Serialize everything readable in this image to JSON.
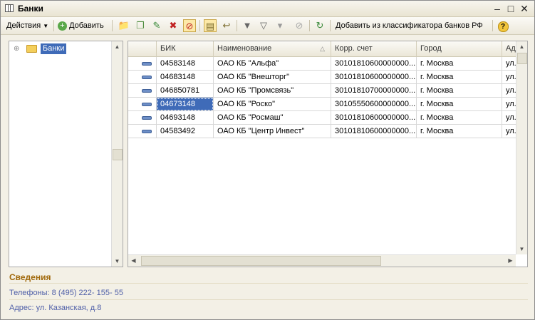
{
  "window": {
    "title": "Банки"
  },
  "toolbar": {
    "actions_label": "Действия",
    "add_label": "Добавить",
    "add_from_classifier_label": "Добавить из классификатора банков РФ"
  },
  "tree": {
    "root_label": "Банки"
  },
  "grid": {
    "columns": [
      "БИК",
      "Наименование",
      "Корр. счет",
      "Город",
      "Ад"
    ],
    "rows": [
      {
        "bik": "04583148",
        "name": "ОАО КБ \"Альфа\"",
        "account": "30101810600000000...",
        "city": "г. Москва",
        "addr": "ул."
      },
      {
        "bik": "04683148",
        "name": "ОАО КБ \"Внешторг\"",
        "account": "30101810600000000...",
        "city": "г. Москва",
        "addr": "ул."
      },
      {
        "bik": "046850781",
        "name": "ОАО КБ \"Промсвязь\"",
        "account": "30101810700000000...",
        "city": "г. Москва",
        "addr": "ул."
      },
      {
        "bik": "04673148",
        "name": "ОАО КБ \"Роско\"",
        "account": "30105550600000000...",
        "city": "г. Москва",
        "addr": "ул."
      },
      {
        "bik": "04693148",
        "name": "ОАО КБ \"Росмаш\"",
        "account": "30101810600000000...",
        "city": "г. Москва",
        "addr": "ул."
      },
      {
        "bik": "04583492",
        "name": "ОАО КБ \"Центр Инвест\"",
        "account": "30101810600000000...",
        "city": "г. Москва",
        "addr": "ул."
      }
    ],
    "selected_row": 3
  },
  "info": {
    "title": "Сведения",
    "phones": "Телефоны: 8 (495) 222- 155- 55",
    "address": "Адрес: ул. Казанская, д.8"
  },
  "colors": {
    "selection": "#3f6bb8",
    "info_title": "#a0680a",
    "info_text": "#4f5fa8"
  }
}
